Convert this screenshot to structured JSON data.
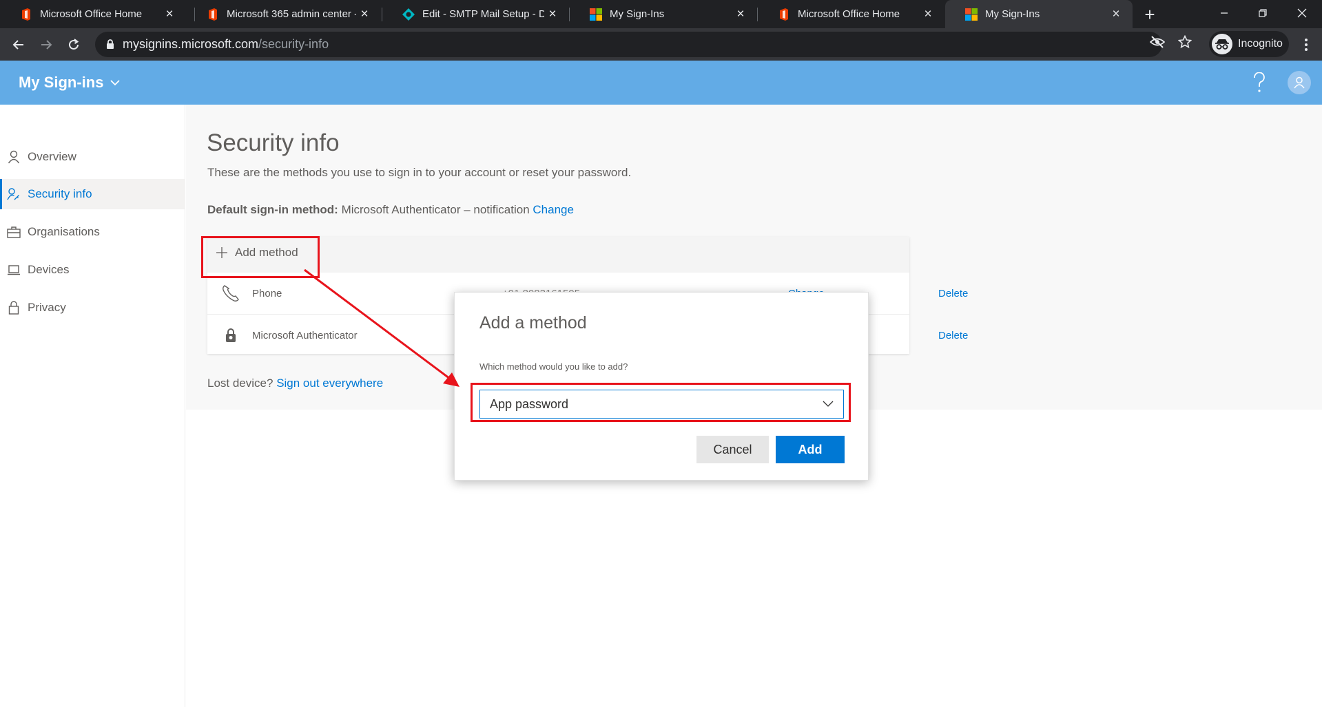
{
  "browser": {
    "tabs": [
      {
        "title": "Microsoft Office Home",
        "favicon": "office-icon",
        "active": false
      },
      {
        "title": "Microsoft 365 admin center -",
        "favicon": "office-icon",
        "active": false
      },
      {
        "title": "Edit - SMTP Mail Setup - Dyn",
        "favicon": "dynamics-icon",
        "active": false
      },
      {
        "title": "My Sign-Ins",
        "favicon": "microsoft-logo-icon",
        "active": false
      },
      {
        "title": "Microsoft Office Home",
        "favicon": "office-icon",
        "active": false
      },
      {
        "title": "My Sign-Ins",
        "favicon": "microsoft-logo-icon",
        "active": true
      }
    ],
    "url_host": "mysignins.microsoft.com",
    "url_path": "/security-info",
    "profile_label": "Incognito"
  },
  "header": {
    "app_title": "My Sign-ins"
  },
  "sidebar": {
    "items": [
      {
        "label": "Overview",
        "icon": "person-icon",
        "selected": false
      },
      {
        "label": "Security info",
        "icon": "person-key-icon",
        "selected": true
      },
      {
        "label": "Organisations",
        "icon": "briefcase-icon",
        "selected": false
      },
      {
        "label": "Devices",
        "icon": "laptop-icon",
        "selected": false
      },
      {
        "label": "Privacy",
        "icon": "lock-icon",
        "selected": false
      }
    ]
  },
  "main": {
    "title": "Security info",
    "description": "These are the methods you use to sign in to your account or reset your password.",
    "default_label": "Default sign-in method:",
    "default_value": "Microsoft Authenticator – notification",
    "default_change": "Change",
    "add_method_label": "Add method",
    "methods": [
      {
        "name": "Phone",
        "icon": "phone-icon",
        "value": "+91 8983161595",
        "change": "Change",
        "delete": "Delete"
      },
      {
        "name": "Microsoft Authenticator",
        "icon": "authenticator-icon",
        "delete": "Delete"
      }
    ],
    "lost_device_text": "Lost device?",
    "sign_out_link": "Sign out everywhere"
  },
  "dialog": {
    "title": "Add a method",
    "question": "Which method would you like to add?",
    "selected_option": "App password",
    "cancel_label": "Cancel",
    "add_label": "Add"
  },
  "colors": {
    "header_blue": "#62abe6",
    "accent_blue": "#0078d4",
    "annotation_red": "#e8141c",
    "chrome_dark": "#202124"
  }
}
